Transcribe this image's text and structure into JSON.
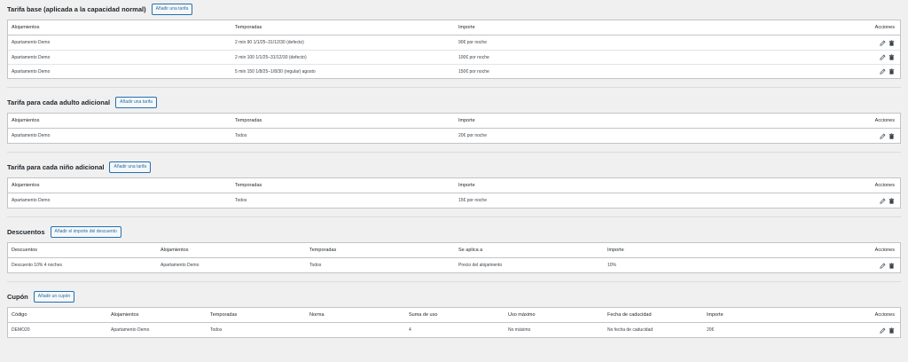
{
  "sections": {
    "base": {
      "title": "Tarifa base (aplicada a la capacidad normal)",
      "add_label": "Añadir una tarifa",
      "columns": [
        "Alojamientos",
        "Temporadas",
        "Importe",
        "Acciones"
      ],
      "rows": [
        [
          "Apartamento Demo",
          "2 min 90 1/1/25–31/12/30 (defecto)",
          "90€ por noche"
        ],
        [
          "Apartamento Demo",
          "2 min 100 1/1/25–31/12/30 (defecto)",
          "100€ por noche"
        ],
        [
          "Apartamento Demo",
          "5 min 150 1/8/25–1/8/30 (regular) agosto",
          "150€ por noche"
        ]
      ]
    },
    "adult": {
      "title": "Tarifa para cada adulto adicional",
      "add_label": "Añadir una tarifa",
      "columns": [
        "Alojamientos",
        "Temporadas",
        "Importe",
        "Acciones"
      ],
      "rows": [
        [
          "Apartamento Demo",
          "Todos",
          "20€ por noche"
        ]
      ]
    },
    "child": {
      "title": "Tarifa para cada niño adicional",
      "add_label": "Añadir una tarifa",
      "columns": [
        "Alojamientos",
        "Temporadas",
        "Importe",
        "Acciones"
      ],
      "rows": [
        [
          "Apartamento Demo",
          "Todos",
          "15€ por noche"
        ]
      ]
    },
    "discounts": {
      "title": "Descuentos",
      "add_label": "Añadir el importe del descuento",
      "columns": [
        "Descuentos",
        "Alojamientos",
        "Temporadas",
        "Se aplica a",
        "Importe",
        "Acciones"
      ],
      "rows": [
        [
          "Descuento 10% 4 noches",
          "Apartamento Demo",
          "Todos",
          "Precio del alojamiento",
          "10%"
        ]
      ]
    },
    "coupon": {
      "title": "Cupón",
      "add_label": "Añadir un cupón",
      "columns": [
        "Código",
        "Alojamientos",
        "Temporadas",
        "Norma",
        "Suma de uso",
        "Uso máximo",
        "Fecha de caducidad",
        "Importe",
        "Acciones"
      ],
      "rows": [
        [
          "DEMO20",
          "Apartamento Demo",
          "Todos",
          "",
          "4",
          "No máximo",
          "No fecha de caducidad",
          "20€"
        ]
      ]
    }
  },
  "icons": {
    "edit": "pencil-icon",
    "delete": "trash-icon"
  },
  "colors": {
    "accent": "#2271b1",
    "border": "#c3c4c7",
    "background": "#f0f0f1"
  }
}
